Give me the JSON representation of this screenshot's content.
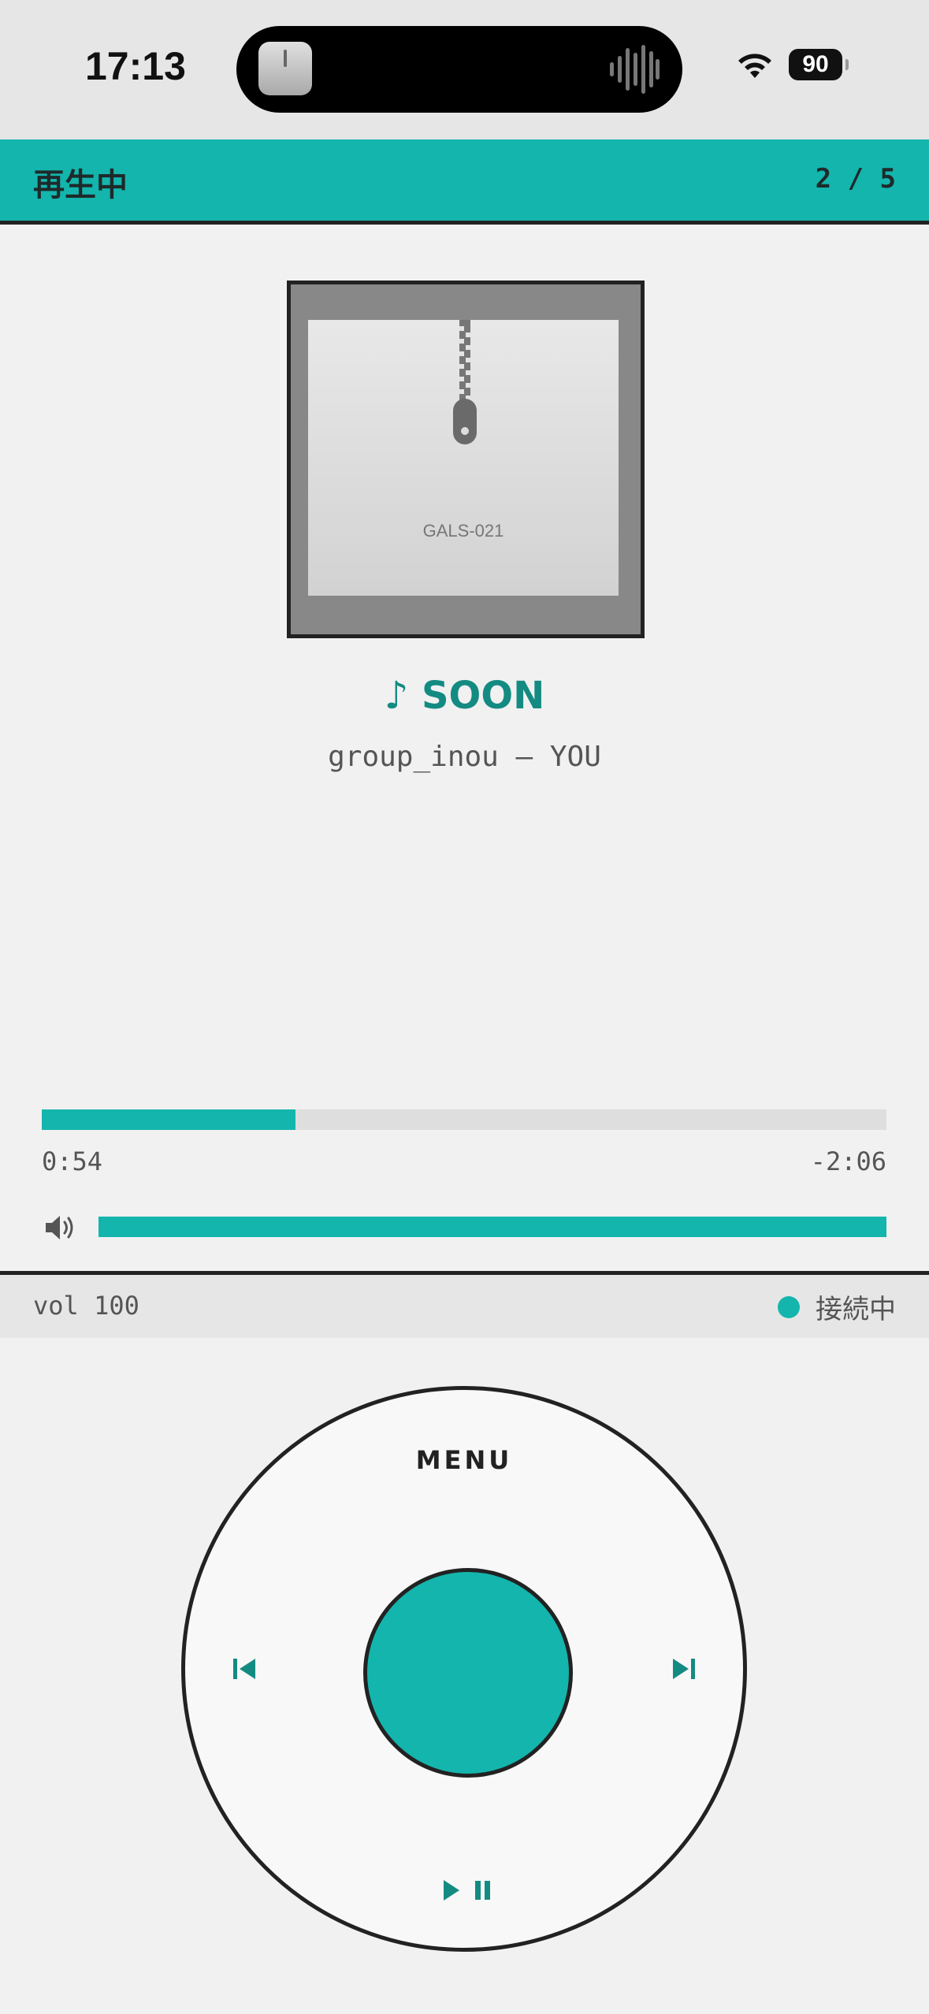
{
  "status_bar": {
    "time": "17:13",
    "battery": "90",
    "icons": [
      "wifi-icon",
      "battery-icon"
    ]
  },
  "header": {
    "title": "再生中",
    "counter": "2 / 5"
  },
  "album": {
    "code": "GALS-021"
  },
  "track": {
    "title": "♪ SOON",
    "artist_line": "group_inou — YOU"
  },
  "progress": {
    "elapsed": "0:54",
    "remaining": "-2:06",
    "fraction": 0.3
  },
  "volume": {
    "fraction": 1.0,
    "label": "vol 100"
  },
  "connection": {
    "status": "接続中"
  },
  "wheel": {
    "menu_label": "MENU",
    "icons": [
      "previous-icon",
      "next-icon",
      "play-pause-icon"
    ]
  },
  "colors": {
    "accent": "#14b5ad",
    "title": "#148b82",
    "border": "#222222"
  }
}
